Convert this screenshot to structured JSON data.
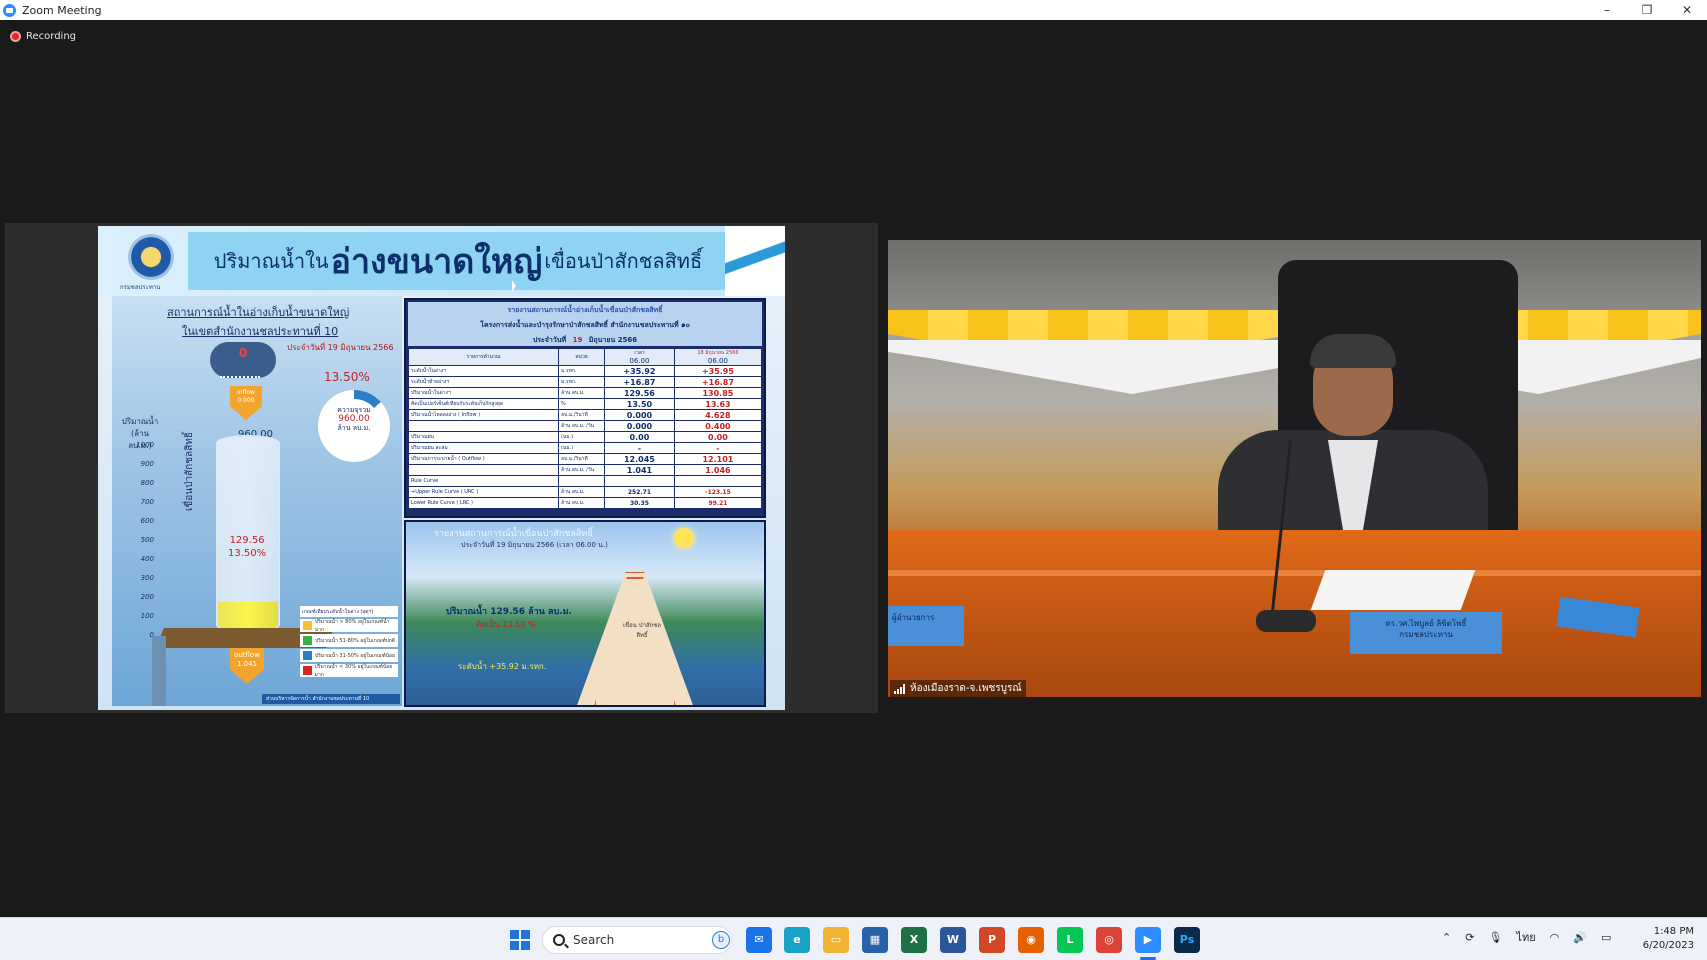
{
  "window": {
    "title": "Zoom Meeting",
    "controls": {
      "minimize": "–",
      "restore": "❐",
      "close": "✕"
    }
  },
  "recording": {
    "label": "Recording"
  },
  "slide": {
    "title_pre": "ปริมาณน้ำใน",
    "title_main": "อ่างขนาดใหญ่",
    "title_post": "เขื่อนป่าสักชลสิทธิ์",
    "seal_caption": "กรมชลประทาน",
    "left": {
      "heading1": "สถานการณ์น้ำในอ่างเก็บน้ำขนาดใหญ่",
      "heading2": "ในเขตสำนักงานชลประทานที่ 10",
      "date": "ประจำวันที่ 19 มิถุนายน 2566",
      "rain_value": "0",
      "inflow_label": "inflow",
      "inflow_value": "0.000",
      "percent_top": "13.50%",
      "capacity_label": "ความจุรวม",
      "capacity_value": "960.00",
      "capacity_unit": "ล้าน ลบ.ม.",
      "capacity_top": "960.00",
      "y_axis_label_1": "ปริมาณน้ำ",
      "y_axis_label_2": "(ล้าน ลบ.ม.)",
      "y_ticks": [
        "1000",
        "900",
        "800",
        "700",
        "600",
        "500",
        "400",
        "300",
        "200",
        "100",
        "0"
      ],
      "current_volume": "129.56",
      "current_percent": "13.50%",
      "dam_vertical_label": "เขื่อนป่าสักชลสิทธิ์",
      "outflow_label": "outflow",
      "outflow_value": "1.041",
      "legend_title": "เกณฑ์เทียบระดับน้ำในอ่าง (อุตุฯ)",
      "legend_items": [
        {
          "color": "#f6c233",
          "label": "ปริมาณน้ำ > 80% อยู่ในเกณฑ์น้ำมาก"
        },
        {
          "color": "#3fae49",
          "label": "ปริมาณน้ำ 51-80% อยู่ในเกณฑ์ปกติ"
        },
        {
          "color": "#2c7ec7",
          "label": "ปริมาณน้ำ 31-50% อยู่ในเกณฑ์น้อย"
        },
        {
          "color": "#d62828",
          "label": "ปริมาณน้ำ < 30% อยู่ในเกณฑ์น้อยมาก"
        }
      ],
      "footer": "ส่วนบริหารจัดการน้ำ สำนักงานชลประทานที่ 10"
    },
    "report": {
      "line1": "รายงานสถานการณ์น้ำอ่างเก็บน้ำเขื่อนป่าสักชลสิทธิ์",
      "line2": "โครงการส่งน้ำและบำรุงรักษาป่าสักชลสิทธิ์ สำนักงานชลประทานที่ ๑๐",
      "line3_pre": "ประจำวันที่",
      "line3_day": "19",
      "line3_month": "มิถุนายน",
      "line3_year": "2566",
      "col_item": "รายการคำนวณ",
      "col_unit": "หน่วย",
      "col_today": "เวลา",
      "col_prev": "18 มิถุนายน 2566",
      "time_today": "06.00",
      "time_prev": "06.00",
      "rows": [
        {
          "item": "ระดับน้ำในอ่างฯ",
          "unit": "ม.รทก.",
          "today": "+35.92",
          "prev": "+35.95"
        },
        {
          "item": "ระดับน้ำท้ายอ่างฯ",
          "unit": "ม.รทก.",
          "today": "+16.87",
          "prev": "+16.87"
        },
        {
          "item": "ปริมาณน้ำในอ่างฯ",
          "unit": "ล้าน ลบ.ม.",
          "today": "129.56",
          "prev": "130.85"
        },
        {
          "item": "คิดเป็นเปอร์เซ็นต์เทียบกับระดับเก็บกักสูงสุด",
          "unit": "%",
          "today": "13.50",
          "prev": "13.63"
        },
        {
          "item": "ปริมาณน้ำไหลลงอ่าง ( Inflow )",
          "unit": "ลบ.ม./วินาที",
          "today": "0.000",
          "prev": "4.628"
        },
        {
          "item": "",
          "unit": "ล้าน ลบ.ม. /วัน",
          "today": "0.000",
          "prev": "0.400"
        },
        {
          "item": "ปริมาณฝน",
          "unit": "(มม.)",
          "today": "0.00",
          "prev": "0.00"
        },
        {
          "item": "ปริมาณฝน สะสม",
          "unit": "(มม.)",
          "today": "-",
          "prev": "-"
        },
        {
          "item": "ปริมาณการระบายน้ำ ( Outflow )",
          "unit": "ลบ.ม./วินาที",
          "today": "12.045",
          "prev": "12.101"
        },
        {
          "item": "",
          "unit": "ล้าน ลบ.ม. /วัน",
          "today": "1.041",
          "prev": "1.046"
        },
        {
          "item": "Rule Curve",
          "unit": "",
          "today": "",
          "prev": ""
        },
        {
          "item": "+Upper Rule Curve ( URC )",
          "unit": "ล้าน ลบ.ม.",
          "today": "252.71",
          "prev": "-123.15"
        },
        {
          "item": "Lower Rule Curve ( LRC )",
          "unit": "ล้าน ลบ.ม.",
          "today": "30.35",
          "prev": "99.21"
        }
      ]
    },
    "reservoir": {
      "title": "รายงานสถานการณ์น้ำเขื่อนป่าสักชลสิทธิ์",
      "date": "ประจำวันที่ 19 มิถุนายน 2566 (เวลา 06.00 น.)",
      "volume": "ปริมาณน้ำ 129.56 ล้าน ลบ.ม.",
      "percent": "คิดเป็น 13.50 %",
      "level": "ระดับน้ำ +35.92 ม.รทก.",
      "dam_label": "เขื่อน ป่าสักชลสิทธิ์"
    }
  },
  "video": {
    "participant_label": "ห้องเมืองราด-จ.เพชรบูรณ์",
    "nameplate_main": "ดร.วศ.ไพบูลย์ ลิขิตโพธิ์",
    "nameplate_sub": "กรมชลประทาน",
    "nameplate_left": "ผู้อำนวยการ"
  },
  "taskbar": {
    "search_placeholder": "Search",
    "apps": [
      {
        "name": "mail",
        "glyph": "✉",
        "color": "#1a73e8"
      },
      {
        "name": "edge",
        "glyph": "e",
        "color": "#1aa3c9"
      },
      {
        "name": "file-explorer",
        "glyph": "▭",
        "color": "#f2b233"
      },
      {
        "name": "store",
        "glyph": "▦",
        "color": "#2862a8"
      },
      {
        "name": "excel",
        "glyph": "X",
        "color": "#1e7145"
      },
      {
        "name": "word",
        "glyph": "W",
        "color": "#2b579a"
      },
      {
        "name": "powerpoint",
        "glyph": "P",
        "color": "#d24726"
      },
      {
        "name": "firefox",
        "glyph": "◉",
        "color": "#e66000"
      },
      {
        "name": "line",
        "glyph": "L",
        "color": "#06c755"
      },
      {
        "name": "chrome",
        "glyph": "◎",
        "color": "#db4437"
      },
      {
        "name": "zoom",
        "glyph": "▶",
        "color": "#2d8cff"
      },
      {
        "name": "photoshop",
        "glyph": "Ps",
        "color": "#0a2a4a"
      }
    ],
    "tray_language": "ไทย",
    "time": "1:48 PM",
    "date": "6/20/2023"
  }
}
